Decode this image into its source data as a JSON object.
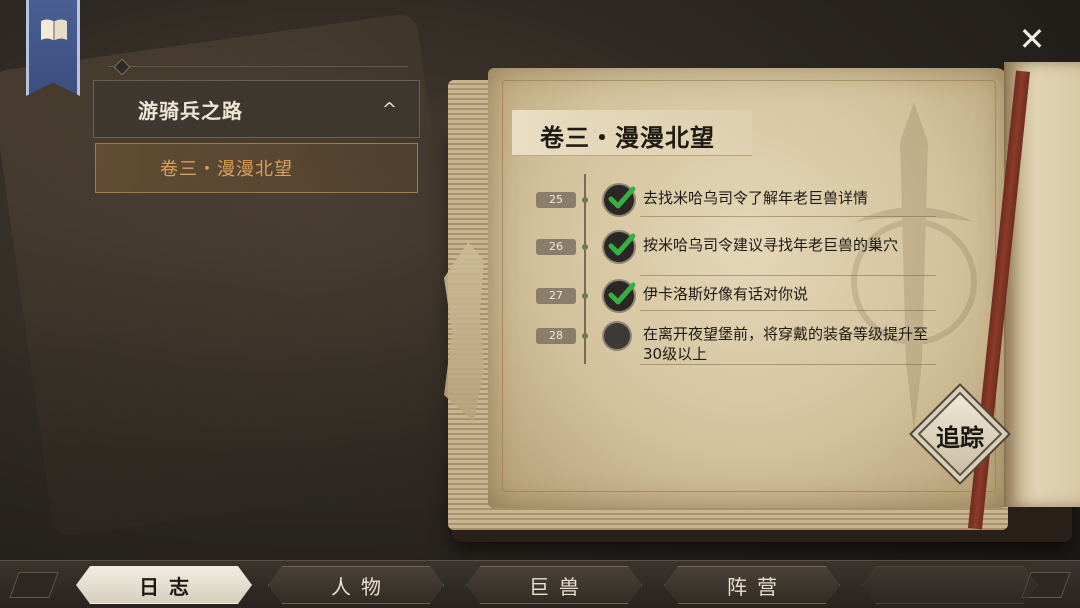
{
  "close_button": {
    "icon": "close-icon",
    "glyph": "✕"
  },
  "banner": {
    "icon": "book-icon",
    "color": "#3b4e80"
  },
  "menu": {
    "header_label": "游骑兵之路",
    "header_chevron": "^",
    "items": [
      {
        "label": "卷三・漫漫北望",
        "selected": true
      }
    ]
  },
  "book": {
    "chapter_title": "卷三・漫漫北望",
    "quests": [
      {
        "number": "25",
        "text": "去找米哈乌司令了解年老巨兽详情",
        "completed": true
      },
      {
        "number": "26",
        "text": "按米哈乌司令建议寻找年老巨兽的巢穴",
        "completed": true
      },
      {
        "number": "27",
        "text": "伊卡洛斯好像有话对你说",
        "completed": true
      },
      {
        "number": "28",
        "text": "在离开夜望堡前，将穿戴的装备等级提升至30级以上",
        "completed": false
      }
    ],
    "track_button": "追踪"
  },
  "nav": {
    "tabs": [
      {
        "label": "日志",
        "active": true
      },
      {
        "label": "人物",
        "active": false
      },
      {
        "label": "巨兽",
        "active": false
      },
      {
        "label": "阵营",
        "active": false
      }
    ]
  },
  "colors": {
    "check_green": "#35b043",
    "selected_text": "#d9a05c",
    "parchment": "#e4d7b8"
  }
}
